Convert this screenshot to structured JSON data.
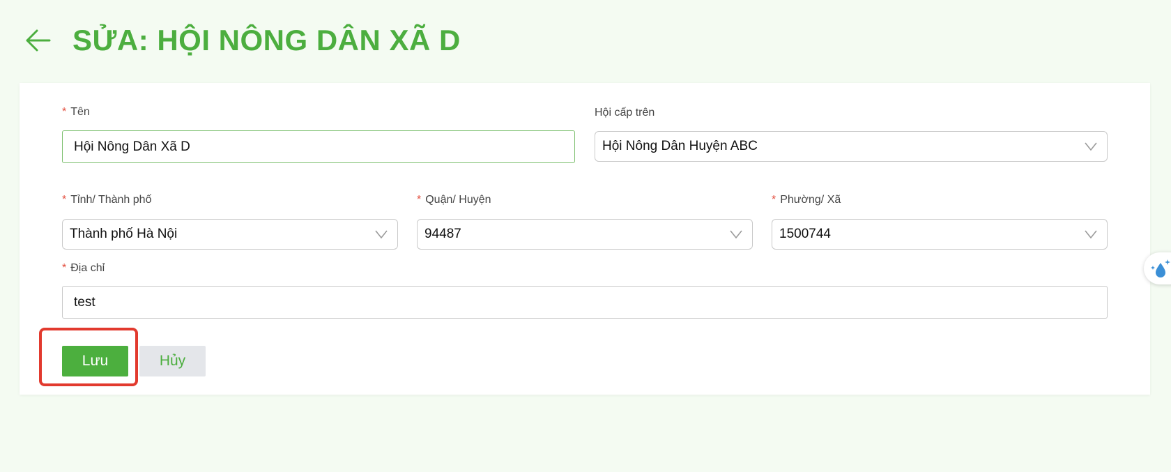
{
  "header": {
    "title": "SỬA: HỘI NÔNG DÂN XÃ D"
  },
  "form": {
    "required_mark": "*",
    "name": {
      "label": "Tên",
      "value": "Hội Nông Dân Xã D"
    },
    "parent": {
      "label": "Hội cấp trên",
      "value": "Hội Nông Dân Huyện ABC"
    },
    "province": {
      "label": "Tỉnh/ Thành phố",
      "value": "Thành phố Hà Nội"
    },
    "district": {
      "label": "Quận/ Huyện",
      "value": "94487"
    },
    "ward": {
      "label": "Phường/ Xã",
      "value": "1500744"
    },
    "address": {
      "label": "Địa chỉ",
      "value": "test"
    }
  },
  "actions": {
    "save_label": "Lưu",
    "cancel_label": "Hủy"
  },
  "colors": {
    "brand_green": "#4cae3f",
    "highlight_red": "#e23a2e",
    "required_red": "#e24b3b"
  },
  "icons": {
    "back": "arrow-left-icon",
    "dropdown": "chevron-down-icon",
    "widget": "water-drop-sparkle-icon"
  }
}
